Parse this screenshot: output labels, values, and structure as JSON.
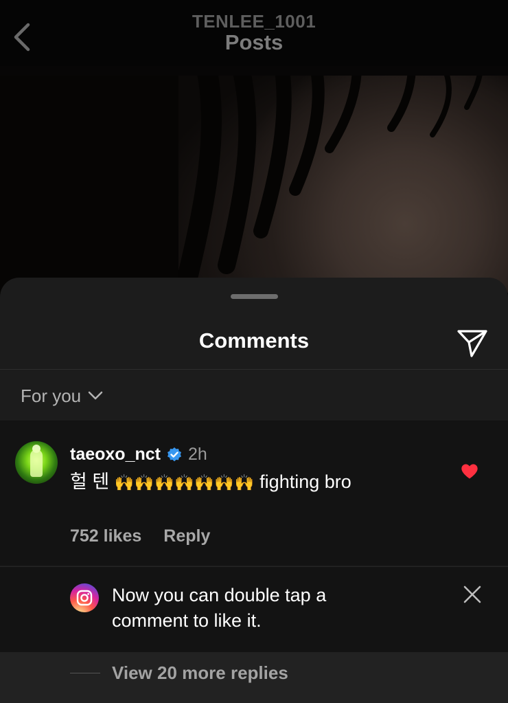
{
  "header": {
    "account": "TENLEE_1001",
    "title": "Posts"
  },
  "sheet": {
    "title": "Comments",
    "filter_label": "For you"
  },
  "comment": {
    "username": "taeoxo_nct",
    "time": "2h",
    "text_korean": "헐 텐",
    "text_emojis": "🙌🙌🙌🙌🙌🙌🙌",
    "text_rest": " fighting bro",
    "likes": "752 likes",
    "reply_label": "Reply",
    "liked": true
  },
  "tip": {
    "text": "Now you can double tap a comment to like it."
  },
  "replies": {
    "label": "View 20 more replies"
  },
  "colors": {
    "accent_heart": "#ff3040",
    "verified_blue": "#3897f0",
    "sheet_bg": "#1c1c1c"
  }
}
